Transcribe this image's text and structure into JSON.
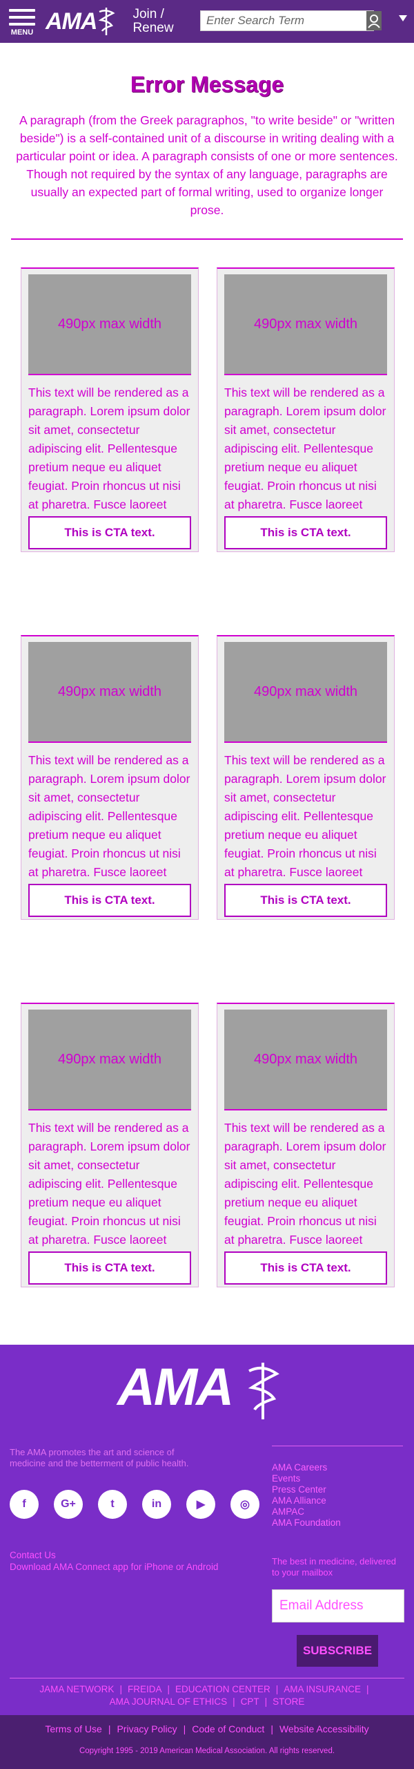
{
  "header": {
    "menu_label": "MENU",
    "logo_text": "AMA",
    "join_line1": "Join /",
    "join_line2": "Renew",
    "search_placeholder": "Enter Search Term"
  },
  "error": {
    "title": "Error Message",
    "paragraph": "A paragraph (from the Greek paragraphos, \"to write beside\" or \"written beside\") is a self-contained unit of a discourse in writing dealing with a particular point or idea. A paragraph consists of one or more sentences. Though not required by the syntax of any language, paragraphs are usually an expected part of formal writing, used to organize longer prose."
  },
  "cards": [
    {
      "image_label": "490px max width",
      "text": "This text will be rendered as a paragraph. Lorem ipsum dolor sit amet, consectetur adipiscing elit. Pellentesque pretium neque eu aliquet feugiat. Proin rhoncus ut nisi at pharetra. Fusce laoreet malesuada ex, eget porttitor ante interdum in.",
      "cta": "This is CTA text."
    },
    {
      "image_label": "490px max width",
      "text": "This text will be rendered as a paragraph. Lorem ipsum dolor sit amet, consectetur adipiscing elit. Pellentesque pretium neque eu aliquet feugiat. Proin rhoncus ut nisi at pharetra. Fusce laoreet malesuada ex, eget porttitor ante interdum in.",
      "cta": "This is CTA text."
    },
    {
      "image_label": "490px max width",
      "text": "This text will be rendered as a paragraph. Lorem ipsum dolor sit amet, consectetur adipiscing elit. Pellentesque pretium neque eu aliquet feugiat. Proin rhoncus ut nisi at pharetra. Fusce laoreet malesuada ex, eget porttitor ante interdum in.",
      "cta": "This is CTA text."
    },
    {
      "image_label": "490px max width",
      "text": "This text will be rendered as a paragraph. Lorem ipsum dolor sit amet, consectetur adipiscing elit. Pellentesque pretium neque eu aliquet feugiat. Proin rhoncus ut nisi at pharetra. Fusce laoreet malesuada ex, eget porttitor ante interdum in.",
      "cta": "This is CTA text."
    },
    {
      "image_label": "490px max width",
      "text": "This text will be rendered as a paragraph. Lorem ipsum dolor sit amet, consectetur adipiscing elit. Pellentesque pretium neque eu aliquet feugiat. Proin rhoncus ut nisi at pharetra. Fusce laoreet malesuada ex, eget porttitor ante interdum in.",
      "cta": "This is CTA text."
    },
    {
      "image_label": "490px max width",
      "text": "This text will be rendered as a paragraph. Lorem ipsum dolor sit amet, consectetur adipiscing elit. Pellentesque pretium neque eu aliquet feugiat. Proin rhoncus ut nisi at pharetra. Fusce laoreet malesuada ex, eget porttitor ante interdum in.",
      "cta": "This is CTA text."
    }
  ],
  "footer": {
    "logo_text": "AMA",
    "about": "The AMA promotes the art and science of medicine and the betterment of public health.",
    "links": [
      "AMA Careers",
      "Events",
      "Press Center",
      "AMA Alliance",
      "AMPAC",
      "AMA Foundation"
    ],
    "socials": [
      {
        "icon": "facebook-icon",
        "glyph": "f"
      },
      {
        "icon": "google-plus-icon",
        "glyph": "G+"
      },
      {
        "icon": "twitter-icon",
        "glyph": "t"
      },
      {
        "icon": "linkedin-icon",
        "glyph": "in"
      },
      {
        "icon": "youtube-icon",
        "glyph": "▶"
      },
      {
        "icon": "instagram-icon",
        "glyph": "◎"
      }
    ],
    "contact": "Contact Us",
    "download": "Download AMA Connect app for iPhone or Android",
    "newsletter": "The best in medicine, delivered to your mailbox",
    "email_placeholder": "Email Address",
    "subscribe_label": "SUBSCRIBE",
    "site_links": [
      "JAMA NETWORK",
      "FREIDA",
      "EDUCATION CENTER",
      "AMA INSURANCE",
      "AMA JOURNAL OF ETHICS",
      "CPT",
      "STORE"
    ],
    "legal_links": [
      "Terms of Use",
      "Privacy Policy",
      "Code of Conduct",
      "Website Accessibility"
    ],
    "copyright": "Copyright 1995 - 2019 American Medical Association. All rights reserved."
  },
  "colors": {
    "header_bg": "#5b2a86",
    "accent": "#d000d0",
    "footer_bg": "#7a2dc8",
    "legal_bg": "#4b1f70"
  }
}
